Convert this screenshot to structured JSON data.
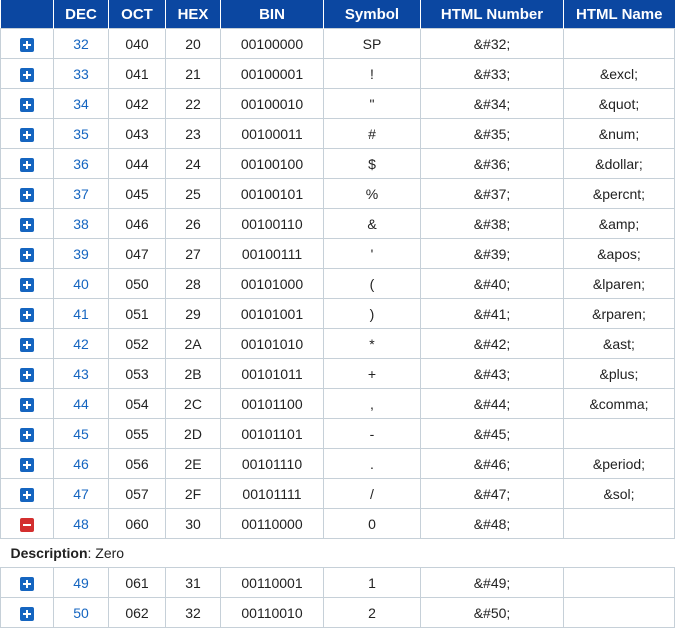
{
  "headers": [
    "",
    "DEC",
    "OCT",
    "HEX",
    "BIN",
    "Symbol",
    "HTML Number",
    "HTML Name"
  ],
  "description": {
    "label": "Description",
    "text": ": Zero"
  },
  "rows": [
    {
      "dec": "32",
      "oct": "040",
      "hex": "20",
      "bin": "00100000",
      "sym": "SP",
      "num": "&#32;",
      "name": "",
      "expanded": false
    },
    {
      "dec": "33",
      "oct": "041",
      "hex": "21",
      "bin": "00100001",
      "sym": "!",
      "num": "&#33;",
      "name": "&excl;",
      "expanded": false
    },
    {
      "dec": "34",
      "oct": "042",
      "hex": "22",
      "bin": "00100010",
      "sym": "\"",
      "num": "&#34;",
      "name": "&quot;",
      "expanded": false
    },
    {
      "dec": "35",
      "oct": "043",
      "hex": "23",
      "bin": "00100011",
      "sym": "#",
      "num": "&#35;",
      "name": "&num;",
      "expanded": false
    },
    {
      "dec": "36",
      "oct": "044",
      "hex": "24",
      "bin": "00100100",
      "sym": "$",
      "num": "&#36;",
      "name": "&dollar;",
      "expanded": false
    },
    {
      "dec": "37",
      "oct": "045",
      "hex": "25",
      "bin": "00100101",
      "sym": "%",
      "num": "&#37;",
      "name": "&percnt;",
      "expanded": false
    },
    {
      "dec": "38",
      "oct": "046",
      "hex": "26",
      "bin": "00100110",
      "sym": "&",
      "num": "&#38;",
      "name": "&amp;",
      "expanded": false
    },
    {
      "dec": "39",
      "oct": "047",
      "hex": "27",
      "bin": "00100111",
      "sym": "'",
      "num": "&#39;",
      "name": "&apos;",
      "expanded": false
    },
    {
      "dec": "40",
      "oct": "050",
      "hex": "28",
      "bin": "00101000",
      "sym": "(",
      "num": "&#40;",
      "name": "&lparen;",
      "expanded": false
    },
    {
      "dec": "41",
      "oct": "051",
      "hex": "29",
      "bin": "00101001",
      "sym": ")",
      "num": "&#41;",
      "name": "&rparen;",
      "expanded": false
    },
    {
      "dec": "42",
      "oct": "052",
      "hex": "2A",
      "bin": "00101010",
      "sym": "*",
      "num": "&#42;",
      "name": "&ast;",
      "expanded": false
    },
    {
      "dec": "43",
      "oct": "053",
      "hex": "2B",
      "bin": "00101011",
      "sym": "+",
      "num": "&#43;",
      "name": "&plus;",
      "expanded": false
    },
    {
      "dec": "44",
      "oct": "054",
      "hex": "2C",
      "bin": "00101100",
      "sym": ",",
      "num": "&#44;",
      "name": "&comma;",
      "expanded": false
    },
    {
      "dec": "45",
      "oct": "055",
      "hex": "2D",
      "bin": "00101101",
      "sym": "-",
      "num": "&#45;",
      "name": "",
      "expanded": false
    },
    {
      "dec": "46",
      "oct": "056",
      "hex": "2E",
      "bin": "00101110",
      "sym": ".",
      "num": "&#46;",
      "name": "&period;",
      "expanded": false
    },
    {
      "dec": "47",
      "oct": "057",
      "hex": "2F",
      "bin": "00101111",
      "sym": "/",
      "num": "&#47;",
      "name": "&sol;",
      "expanded": false
    },
    {
      "dec": "48",
      "oct": "060",
      "hex": "30",
      "bin": "00110000",
      "sym": "0",
      "num": "&#48;",
      "name": "",
      "expanded": true
    },
    {
      "dec": "49",
      "oct": "061",
      "hex": "31",
      "bin": "00110001",
      "sym": "1",
      "num": "&#49;",
      "name": "",
      "expanded": false
    },
    {
      "dec": "50",
      "oct": "062",
      "hex": "32",
      "bin": "00110010",
      "sym": "2",
      "num": "&#50;",
      "name": "",
      "expanded": false
    }
  ],
  "colors": {
    "header_bg": "#0b47a1",
    "plus": "#1565c0",
    "minus": "#d32f2f",
    "dec_link": "#1565c0",
    "border": "#c6d0d8"
  },
  "icons": {
    "expand": "plus-square-icon",
    "collapse": "minus-square-icon"
  }
}
